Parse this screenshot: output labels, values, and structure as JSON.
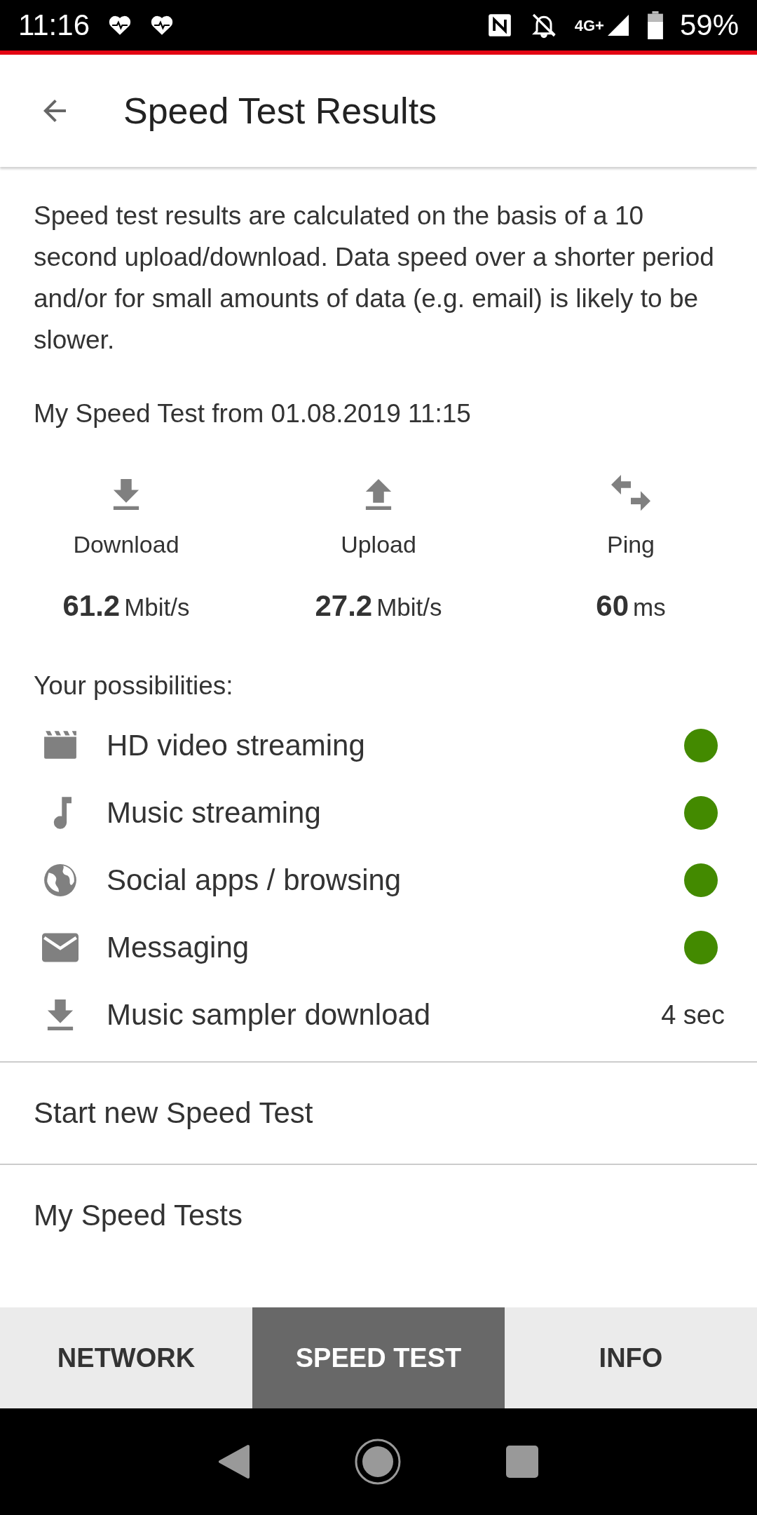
{
  "status_bar": {
    "time": "11:16",
    "network": "4G+",
    "battery": "59%"
  },
  "app_bar": {
    "title": "Speed Test Results"
  },
  "intro": "Speed test results are calculated on the basis of a 10 second upload/download. Data speed over a shorter period and/or for small amounts of data (e.g. email) is likely to be slower.",
  "test_heading": "My Speed Test from 01.08.2019 11:15",
  "metrics": [
    {
      "kind": "download",
      "label": "Download",
      "value": "61.2",
      "unit": "Mbit/s"
    },
    {
      "kind": "upload",
      "label": "Upload",
      "value": "27.2",
      "unit": "Mbit/s"
    },
    {
      "kind": "ping",
      "label": "Ping",
      "value": "60",
      "unit": "ms"
    }
  ],
  "possibilities_heading": "Your possibilities:",
  "possibilities": [
    {
      "kind": "dot",
      "label": "HD video streaming",
      "color": "#438a00"
    },
    {
      "kind": "dot",
      "label": "Music streaming",
      "color": "#438a00"
    },
    {
      "kind": "dot",
      "label": "Social apps / browsing",
      "color": "#438a00"
    },
    {
      "kind": "dot",
      "label": "Messaging",
      "color": "#438a00"
    },
    {
      "kind": "value",
      "label": "Music sampler download",
      "value": "4 sec"
    }
  ],
  "menu_items": [
    "Start new Speed Test",
    "My Speed Tests"
  ],
  "tabs": [
    {
      "label": "NETWORK",
      "selected": false
    },
    {
      "label": "SPEED TEST",
      "selected": true
    },
    {
      "label": "INFO",
      "selected": false
    }
  ]
}
